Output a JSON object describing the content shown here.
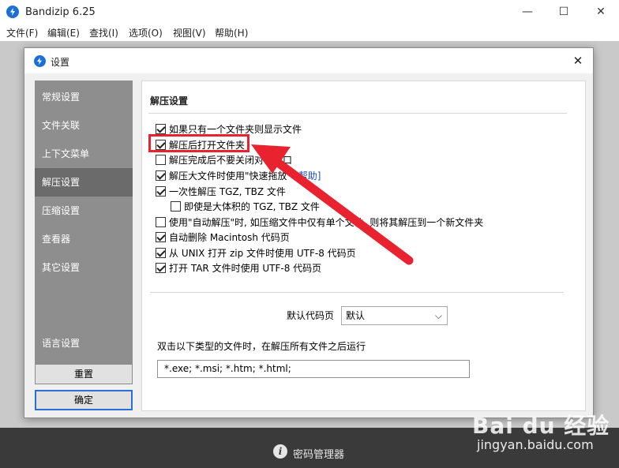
{
  "app": {
    "title": "Bandizip 6.25",
    "minimize_glyph": "—",
    "maximize_glyph": "☐",
    "close_glyph": "✕",
    "menu": [
      "文件(F)",
      "编辑(E)",
      "查找(I)",
      "选项(O)",
      "视图(V)",
      "帮助(H)"
    ],
    "password_manager": "密码管理器"
  },
  "watermark": {
    "brand": "Bai du 经验",
    "url": "jingyan.baidu.com"
  },
  "dialog": {
    "title": "设置",
    "close_glyph": "✕",
    "nav": [
      "常规设置",
      "文件关联",
      "上下文菜单",
      "解压设置",
      "压缩设置",
      "查看器",
      "其它设置",
      "语言设置"
    ],
    "active_nav_index": 3,
    "buttons": {
      "reset": "重置",
      "ok": "确定"
    },
    "section_title": "解压设置",
    "options": [
      {
        "label": "如果只有一个文件夹则显示文件",
        "checked": true
      },
      {
        "label": "解压后打开文件夹",
        "checked": true
      },
      {
        "label": "解压完成后不要关闭对话窗口",
        "checked": false
      },
      {
        "label": "解压大文件时使用\"快速拖放\"",
        "checked": true,
        "link": "[帮助]"
      },
      {
        "label": "一次性解压 TGZ, TBZ 文件",
        "checked": true
      },
      {
        "label": "即使是大体积的 TGZ, TBZ 文件",
        "checked": false
      },
      {
        "label": "使用\"自动解压\"时, 如压缩文件中仅有单个文件, 则将其解压到一个新文件夹",
        "checked": false
      },
      {
        "label": "自动删除 Macintosh 代码页",
        "checked": true
      },
      {
        "label": "从 UNIX 打开 zip 文件时使用 UTF-8 代码页",
        "checked": true
      },
      {
        "label": "打开 TAR 文件时使用 UTF-8 代码页",
        "checked": true
      }
    ],
    "codepage_label": "默认代码页",
    "codepage_value": "默认",
    "run_after_label": "双击以下类型的文件时，在解压所有文件之后运行",
    "run_after_value": "*.exe; *.msi; *.htm; *.html;"
  },
  "colors": {
    "annotation_red": "#e8232f",
    "link_blue": "#1a4fc4"
  }
}
